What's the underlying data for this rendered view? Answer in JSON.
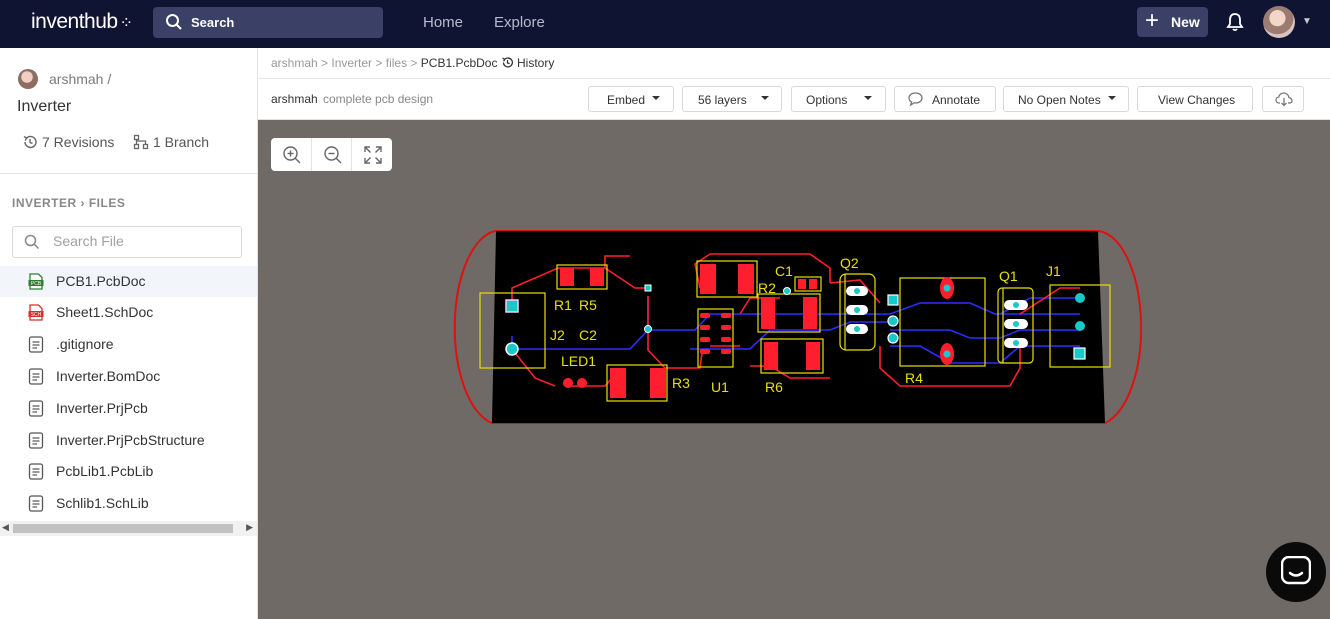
{
  "topbar": {
    "logo": "inventhub",
    "search_label": "Search",
    "nav": {
      "home": "Home",
      "explore": "Explore"
    },
    "new_label": "New"
  },
  "sidebar": {
    "owner": "arshmah /",
    "repo": "Inverter",
    "revisions": "7 Revisions",
    "branches": "1 Branch",
    "breadcrumb": "INVERTER › FILES",
    "search_placeholder": "Search File",
    "files": [
      {
        "name": "PCB1.PcbDoc",
        "icon": "pcb-file-icon",
        "active": true
      },
      {
        "name": "Sheet1.SchDoc",
        "icon": "sch-file-icon"
      },
      {
        "name": ".gitignore",
        "icon": "text-file-icon"
      },
      {
        "name": "Inverter.BomDoc",
        "icon": "text-file-icon"
      },
      {
        "name": "Inverter.PrjPcb",
        "icon": "text-file-icon"
      },
      {
        "name": "Inverter.PrjPcbStructure",
        "icon": "text-file-icon"
      },
      {
        "name": "PcbLib1.PcbLib",
        "icon": "text-file-icon"
      },
      {
        "name": "Schlib1.SchLib",
        "icon": "text-file-icon"
      }
    ]
  },
  "breadcrumb": {
    "path": [
      "arshmah",
      "Inverter",
      "files"
    ],
    "current": "PCB1.PcbDoc",
    "history": "History"
  },
  "toolbar": {
    "author": "arshmah",
    "description": "complete pcb design",
    "embed": "Embed",
    "layers": "56 layers",
    "options": "Options",
    "annotate": "Annotate",
    "notes": "No Open Notes",
    "view_changes": "View Changes"
  },
  "pcb": {
    "designators": [
      "R1",
      "R5",
      "J2",
      "C2",
      "LED1",
      "R3",
      "U1",
      "R6",
      "R2",
      "C1",
      "Q2",
      "R4",
      "Q1",
      "J1"
    ],
    "colors": {
      "board": "#000000",
      "outline": "#e01010",
      "top": "#ff1e2d",
      "bottom": "#2d2dff",
      "silk": "#e8e000",
      "pad": "#19c8c8"
    }
  },
  "colors": {
    "topbar": "#0f1432",
    "canvas": "#6f6a66"
  }
}
